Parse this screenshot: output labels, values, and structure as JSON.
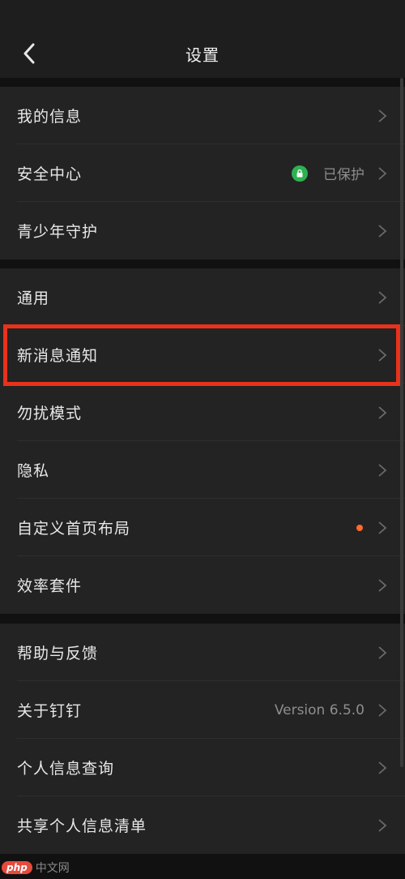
{
  "header": {
    "title": "设置"
  },
  "groups": [
    {
      "items": [
        {
          "label": "我的信息"
        },
        {
          "label": "安全中心",
          "status": "已保护"
        },
        {
          "label": "青少年守护"
        }
      ]
    },
    {
      "items": [
        {
          "label": "通用"
        },
        {
          "label": "新消息通知"
        },
        {
          "label": "勿扰模式"
        },
        {
          "label": "隐私"
        },
        {
          "label": "自定义首页布局"
        },
        {
          "label": "效率套件"
        }
      ]
    },
    {
      "items": [
        {
          "label": "帮助与反馈"
        },
        {
          "label": "关于钉钉",
          "version": "Version 6.5.0"
        },
        {
          "label": "个人信息查询"
        },
        {
          "label": "共享个人信息清单"
        }
      ]
    }
  ],
  "colors": {
    "background": "#111111",
    "row_background": "#232323",
    "highlight_border": "#e8321b",
    "shield_green": "#2db152",
    "dot_orange": "#ff6a2d"
  },
  "watermark": {
    "logo": "php",
    "text": "中文网"
  }
}
